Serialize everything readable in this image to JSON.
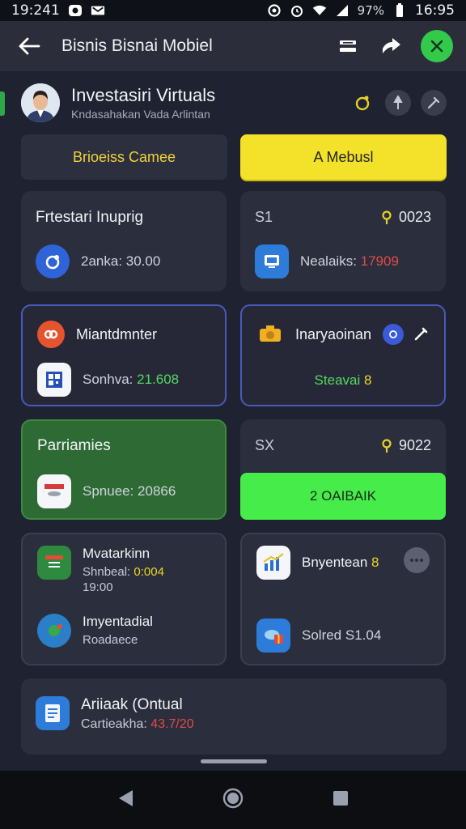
{
  "status_bar": {
    "time_left": "19:241",
    "time_right": "16:95",
    "battery": "97%"
  },
  "app_bar": {
    "title": "Bisnis Bisnai Mobiel"
  },
  "profile": {
    "name": "Investasiri Virtuals",
    "subtitle": "Kndasahakan Vada Arlintan"
  },
  "buttons": {
    "left": "Brioeiss Camee",
    "right": "A Mebusl"
  },
  "cards": [
    {
      "title": "Frtestari Inuprig",
      "row_text": "2anka: 30.00"
    },
    {
      "top_left": "S1",
      "top_right": "0023",
      "row_label": "Nealaiks: ",
      "row_value": "17909"
    },
    {
      "title": "Miantdmnter",
      "row_label": "Sonhva: ",
      "row_value": "21.608"
    },
    {
      "title": "Inaryaoinan",
      "status_label": "Steavai",
      "status_glyph": "8"
    },
    {
      "title": "Parriamies",
      "row_text": "Spnuee: 20866"
    },
    {
      "top_left": "SX",
      "top_right": "9022",
      "button": "2 OAIBAIK"
    },
    {
      "title_1": "Mvatarkinn",
      "line_1a": "Shnbeal: ",
      "line_1a_value": "0:004",
      "line_1b": "19:00",
      "title_2": "Imyentadial",
      "line_2": "Roadaece"
    },
    {
      "title_1": "Bnyentean",
      "title_1_glyph": "8",
      "row_text": "Solred S1.04"
    },
    {
      "title": "Ariiaak (Ontual",
      "row_label": "Cartieakha: ",
      "row_value": "43.7/20"
    }
  ],
  "colors": {
    "accent_yellow": "#f4e12a",
    "accent_green": "#46ec4a",
    "outline_blue": "#4a5ab8",
    "card_bg": "#2b2e3c"
  },
  "icons": [
    "back-arrow-icon",
    "battery-icon",
    "wifi-icon",
    "close-icon",
    "dice-icon",
    "share-icon"
  ]
}
